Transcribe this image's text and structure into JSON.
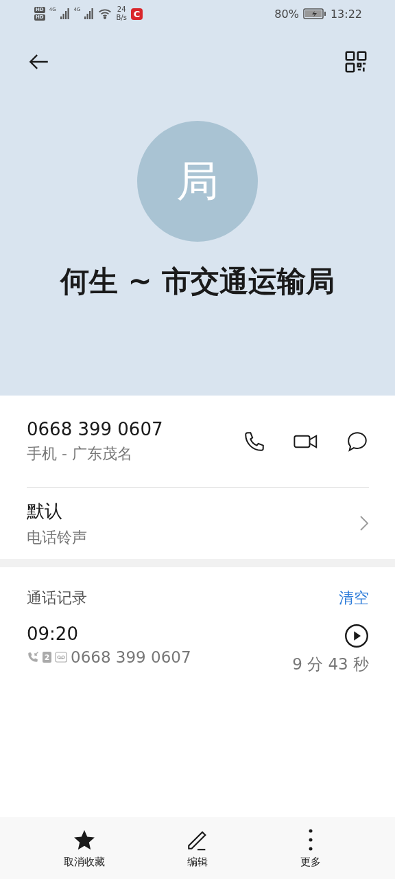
{
  "status_bar": {
    "hd": [
      "HD",
      "HD"
    ],
    "networks": [
      "4G",
      "4G"
    ],
    "net_speed": "24",
    "net_speed_unit": "B/s",
    "app_badge": "C",
    "battery": "80%",
    "time": "13:22"
  },
  "contact": {
    "avatar": "局",
    "name": "何生 ~ 市交通运输局"
  },
  "phone": {
    "number": "0668 399 0607",
    "label": "手机 - 广东茂名"
  },
  "ringtone": {
    "value": "默认",
    "label": "电话铃声"
  },
  "call_log": {
    "title": "通话记录",
    "clear": "清空",
    "entries": [
      {
        "time": "09:20",
        "sim": "2",
        "number": "0668 399 0607",
        "duration": "9 分 43 秒"
      }
    ]
  },
  "actions": [
    {
      "kind": "star",
      "label": "取消收藏"
    },
    {
      "kind": "edit",
      "label": "编辑"
    },
    {
      "kind": "more",
      "label": "更多"
    }
  ]
}
